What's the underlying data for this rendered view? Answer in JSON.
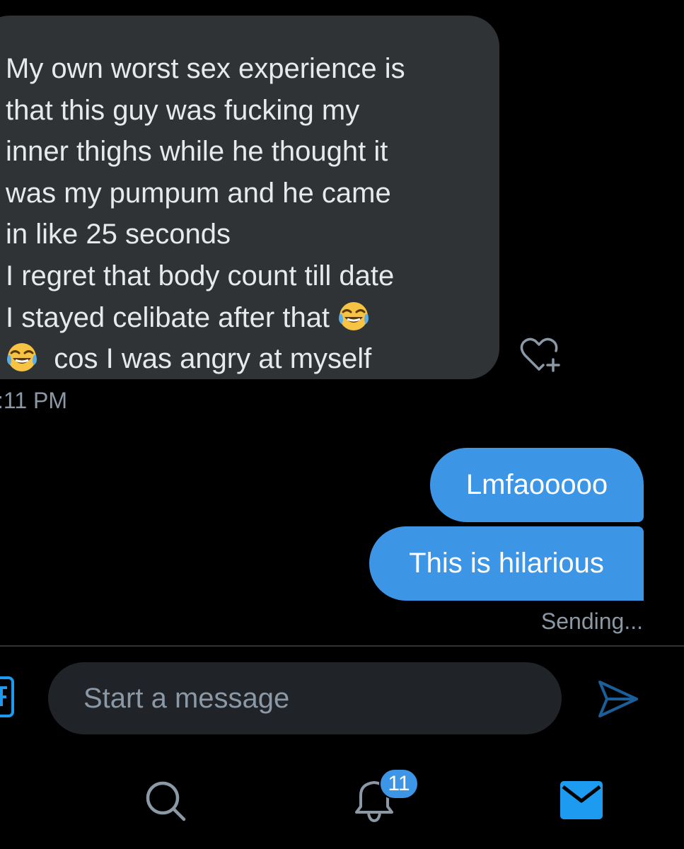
{
  "conversation": {
    "received": {
      "lines": [
        "My own worst sex experience is",
        "that this guy was fucking my",
        "inner thighs while he thought it",
        "was my pumpum and he came",
        "in like 25 seconds",
        "I regret that body count till date",
        "I stayed celibate after that",
        "cos I was angry at myself"
      ],
      "emoji": "face-with-tears-of-joy",
      "timestamp": ":11 PM"
    },
    "sent": [
      {
        "text": "Lmfaooooo"
      },
      {
        "text": "This is hilarious"
      }
    ],
    "status": "Sending..."
  },
  "composer": {
    "placeholder": "Start a message"
  },
  "tabbar": {
    "notification_count": "11"
  },
  "colors": {
    "background": "#000000",
    "received_bubble": "#2f3336",
    "sent_bubble": "#3d95e6",
    "accent": "#1d9bf0",
    "muted_text": "#8b98a5"
  },
  "icons": {
    "like": "heart-plus-icon",
    "gif": "gif-icon",
    "send": "send-icon",
    "search": "search-icon",
    "notifications": "bell-icon",
    "messages": "envelope-icon"
  }
}
